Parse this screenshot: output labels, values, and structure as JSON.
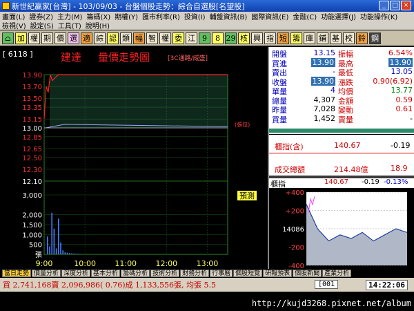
{
  "window": {
    "title": "新世紀贏家[台灣] - 103/09/03 - 台盤個股走勢：綜合自選股[名望股]"
  },
  "menu_row1": [
    "畫面(L)",
    "證券(Z)",
    "主力(M)",
    "籌碼(X)",
    "期權(Y)",
    "匯市利率(R)",
    "投資(I)",
    "輔盤資訊(B)",
    "國際資訊(E)",
    "金融(C)",
    "功能選擇(J)",
    "功能操作(K)"
  ],
  "menu_row2": [
    "檢視(V)",
    "設定(S)",
    "工具(T)",
    "說明(H)"
  ],
  "toolbar": [
    "加",
    "權",
    "期",
    "價",
    "選",
    "適",
    "綜",
    "認",
    "類",
    "幅",
    "智",
    "權",
    "委",
    "江",
    "9",
    "8",
    "29",
    "核",
    "興",
    "指",
    "短",
    "籌",
    "庫",
    "鋪",
    "基",
    "校",
    "鈴",
    "鋼"
  ],
  "stock": {
    "code": "[ 6118 ]",
    "name": "建達",
    "view": "量價走勢圖",
    "sector": "[3C通路/威盛]"
  },
  "price_axis": [
    "13.90",
    "13.70",
    "13.50",
    "13.35",
    "13.15",
    "13.00",
    "12.85",
    "12.65",
    "12.50",
    "12.30",
    "12.10"
  ],
  "volume_axis": [
    "3,000",
    "2,000",
    "1,500",
    "1,000",
    "500",
    "張"
  ],
  "time_axis": [
    "9:00",
    "10:00",
    "11:00",
    "12:00",
    "13:00"
  ],
  "chart_labels": {
    "volume_small": "(張位)",
    "predict": "預測"
  },
  "quote": {
    "open_label": "開盤",
    "open": "13.15",
    "amp_label": "振幅",
    "amp": "6.54%",
    "bid_label": "買進",
    "bid": "13.90",
    "high_label": "最高",
    "high": "13.90",
    "ask_label": "賣出",
    "ask": "-",
    "low_label": "最低",
    "low": "13.05",
    "close_label": "收盤",
    "close": "13.90",
    "chg_label": "漲跌",
    "chg": "0.90(6.92)",
    "unit_label": "單量",
    "unit": "4",
    "avg_label": "均價",
    "avg": "13.77",
    "vol_label": "總量",
    "vol": "4,307",
    "amt_label": "金額",
    "amt": "0.59",
    "prev_label": "昨量",
    "prev": "7,028",
    "varv_label": "變動",
    "varv": "0.61",
    "bq_label": "買量",
    "bq": "1,452",
    "sq_label": "賣量",
    "sq": "-"
  },
  "index": {
    "label": "櫃指(含)",
    "value": "140.67",
    "chg": "-0.19",
    "turnover_label": "成交總額",
    "turnover": "214.48億",
    "turnover_chg": "18.9",
    "mini_label": "櫃指",
    "mini_value": "140.67",
    "mini_chg": "-0.19",
    "mini_pct": "-0.13%",
    "mini_axis": [
      "+400",
      "+200",
      "14086",
      "-200",
      "-400"
    ]
  },
  "tabs": [
    "當日走勢",
    "價量分析",
    "深度分析",
    "基本分析",
    "籌碼分析",
    "技術分析",
    "財務分析",
    "行事曆",
    "個股短覽",
    "研報預表",
    "個股新聞",
    "產業分析"
  ],
  "status": "買 2,741,168賣 2,096,986( 0.76)成 1,133,556張, 均張 5.5",
  "status_code": "[001",
  "clock": "14:22:06",
  "url": "http://kujd3268.pixnet.net/album",
  "chart_data": {
    "type": "line",
    "x": [
      "9:00",
      "9:05",
      "9:10",
      "9:15",
      "9:20",
      "9:30",
      "10:00",
      "11:00",
      "12:00",
      "13:00",
      "13:30"
    ],
    "series": [
      {
        "values": [
          13.15,
          13.7,
          13.6,
          13.9,
          13.8,
          13.9,
          13.9,
          13.9,
          13.9,
          13.9,
          13.9
        ]
      }
    ],
    "volume": [
      900,
      400,
      2100,
      1300,
      300,
      1800,
      600,
      200,
      100,
      80,
      60,
      50,
      40,
      30,
      30,
      20
    ],
    "ylim": [
      12.1,
      13.9
    ],
    "reference": 13.0,
    "vol_ylim": [
      0,
      3000
    ]
  },
  "index_chart": {
    "type": "line",
    "values": [
      140.9,
      140.7,
      140.6,
      140.65,
      140.62,
      140.67,
      140.6,
      140.65,
      140.7,
      140.67
    ],
    "ylim": [
      140.4,
      141.0
    ]
  }
}
